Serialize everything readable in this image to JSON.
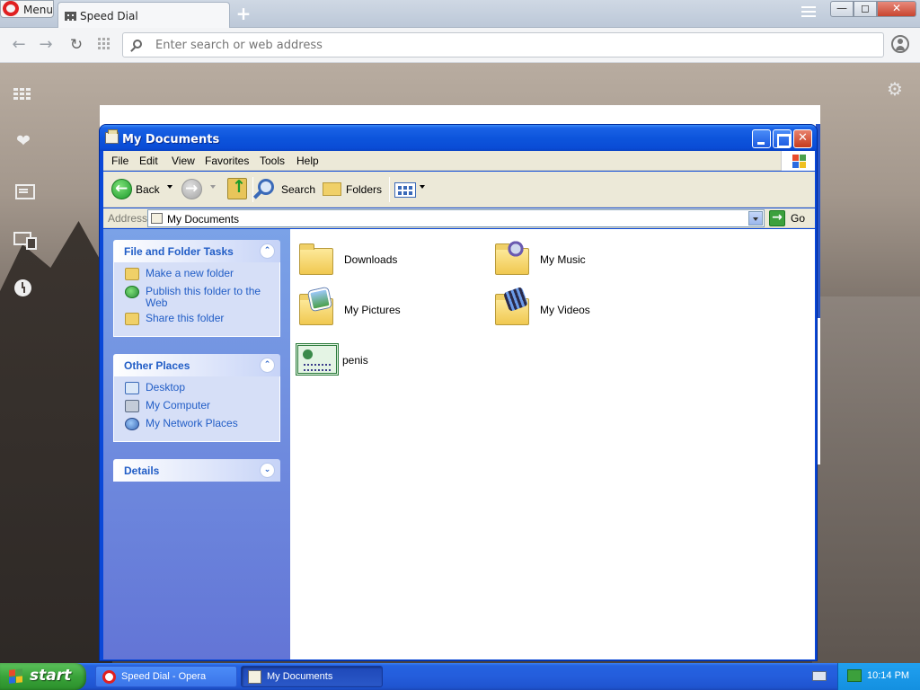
{
  "opera": {
    "menu_label": "Menu",
    "tab_title": "Speed Dial",
    "new_tab_symbol": "+",
    "search_placeholder": "Enter search or web address",
    "window_controls": {
      "minimize": "—",
      "maximize": "◻",
      "close": "✕"
    },
    "icons": [
      "opera-logo-icon",
      "speed-dial-grid-icon",
      "back-arrow-icon",
      "forward-arrow-icon",
      "reload-icon",
      "search-icon",
      "account-icon",
      "heart-icon",
      "news-icon",
      "sync-icon",
      "history-clock-icon",
      "gear-icon"
    ],
    "accent_color": "#e02020"
  },
  "explorer": {
    "title": "My Documents",
    "menu": [
      "File",
      "Edit",
      "View",
      "Favorites",
      "Tools",
      "Help"
    ],
    "toolbar": {
      "back": "Back",
      "search": "Search",
      "folders": "Folders"
    },
    "address": {
      "label": "Address",
      "value": "My Documents",
      "go": "Go"
    },
    "tasks": {
      "file_folder": {
        "title": "File and Folder Tasks",
        "links": [
          "Make a new folder",
          "Publish this folder to the Web",
          "Share this folder"
        ]
      },
      "other_places": {
        "title": "Other Places",
        "links": [
          "Desktop",
          "My Computer",
          "My Network Places"
        ]
      },
      "details": {
        "title": "Details"
      }
    },
    "items": [
      {
        "name": "Downloads",
        "icon": "folder-icon"
      },
      {
        "name": "My Music",
        "icon": "music-folder-icon"
      },
      {
        "name": "My Pictures",
        "icon": "pictures-folder-icon"
      },
      {
        "name": "My Videos",
        "icon": "videos-folder-icon"
      },
      {
        "name": "penis",
        "icon": "certificate-file-icon"
      }
    ],
    "title_bar_color": "#0a4cd6",
    "task_pane_color": "#6375d6"
  },
  "taskbar": {
    "start_label": "start",
    "tasks": [
      "Speed Dial - Opera",
      "My Documents"
    ],
    "clock": "10:14 PM",
    "start_color": "#3aa33a"
  }
}
